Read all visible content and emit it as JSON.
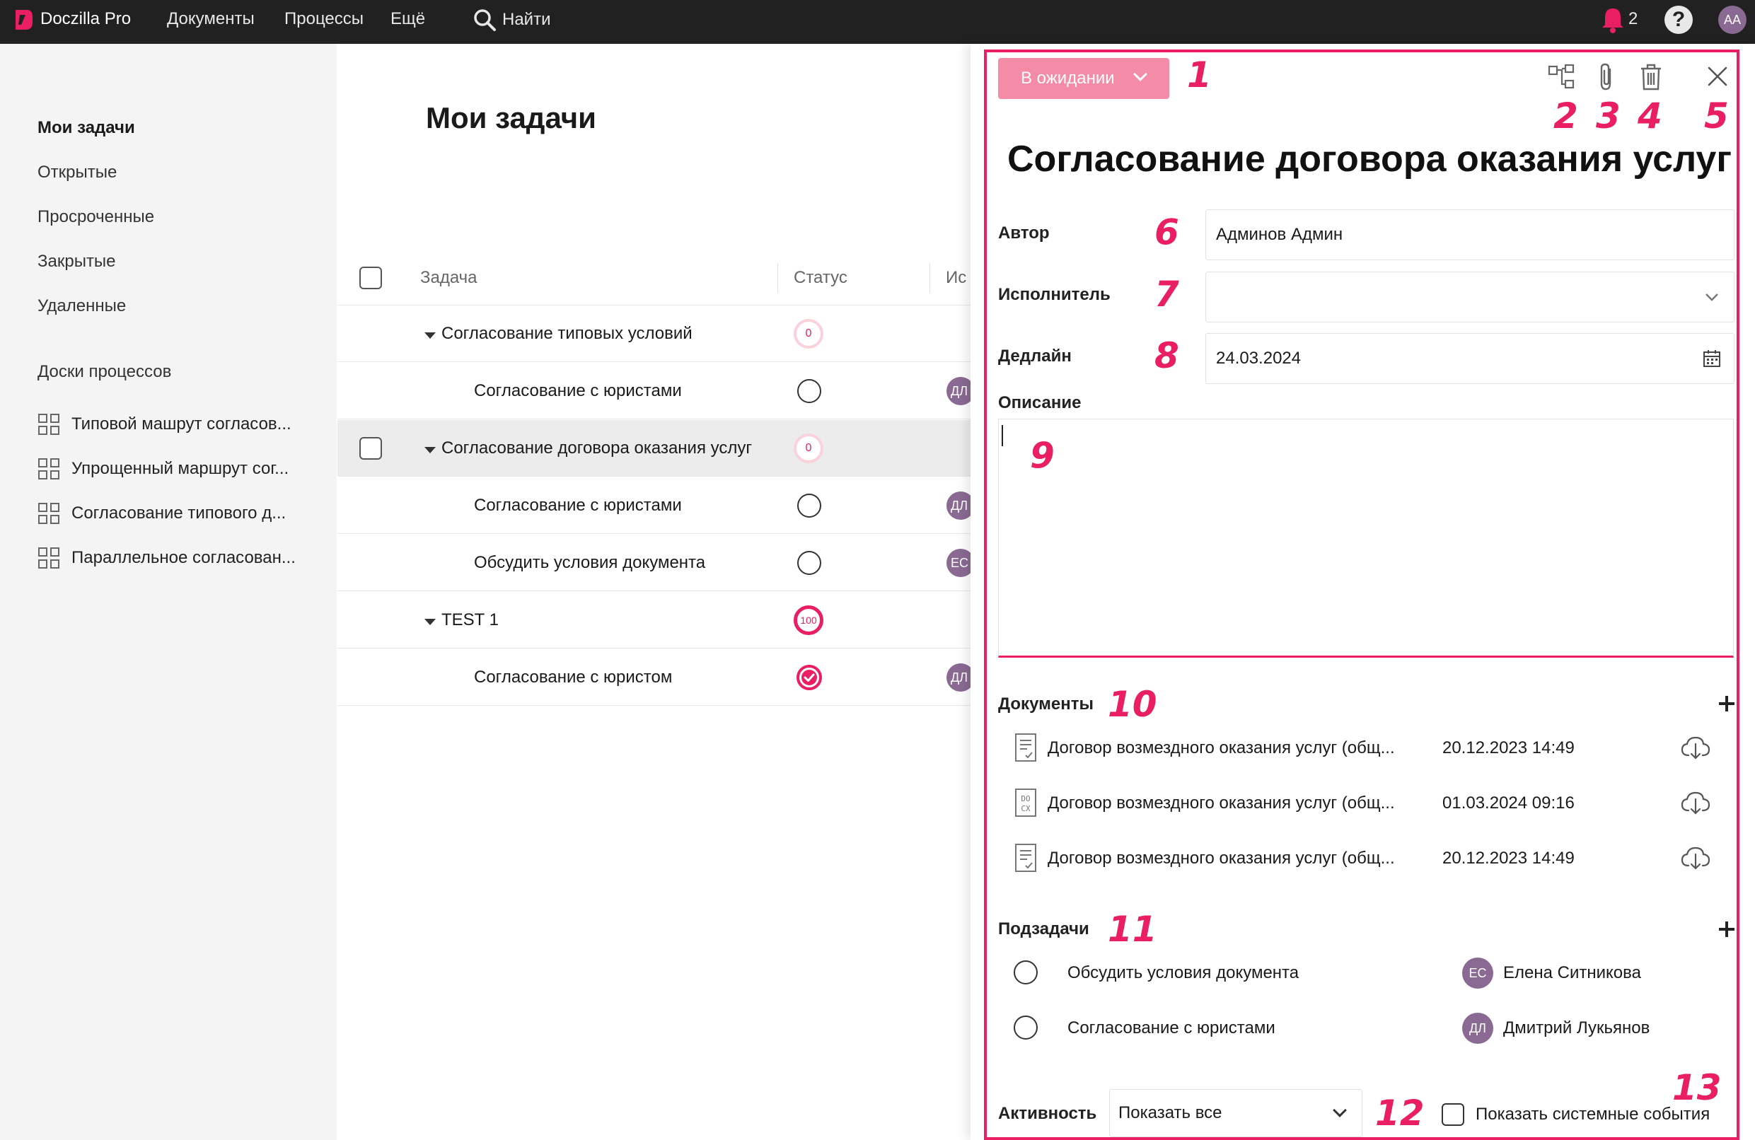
{
  "app": {
    "name": "Doczilla Pro"
  },
  "nav": {
    "documents": "Документы",
    "processes": "Процессы",
    "more": "Ещё",
    "search": "Найти"
  },
  "notifications": {
    "count": "2"
  },
  "help": {
    "label": "?"
  },
  "user": {
    "initials": "AA"
  },
  "sidebar": {
    "items": [
      {
        "label": "Мои задачи"
      },
      {
        "label": "Открытые"
      },
      {
        "label": "Просроченные"
      },
      {
        "label": "Закрытые"
      },
      {
        "label": "Удаленные"
      }
    ],
    "boards_heading": "Доски процессов",
    "boards": [
      {
        "label": "Типовой машрут согласов..."
      },
      {
        "label": "Упрощенный маршрут сог..."
      },
      {
        "label": "Согласование типового д..."
      },
      {
        "label": "Параллельное согласован..."
      }
    ]
  },
  "main": {
    "title": "Мои задачи",
    "columns": {
      "task": "Задача",
      "status": "Статус",
      "assignee": "Ис"
    },
    "rows": [
      {
        "name": "Согласование типовых условий",
        "progress": "0"
      },
      {
        "name": "Согласование с юристами",
        "avatar": "ДЛ"
      },
      {
        "name": "Согласование договора оказания услуг",
        "progress": "0"
      },
      {
        "name": "Согласование с юристами",
        "avatar": "ДЛ"
      },
      {
        "name": "Обсудить условия документа",
        "avatar": "ЕС"
      },
      {
        "name": "TEST 1",
        "progress": "100"
      },
      {
        "name": "Согласование с юристом",
        "avatar": "ДЛ"
      }
    ]
  },
  "detail": {
    "status_button": "В ожидании",
    "title": "Согласование договора оказания услуг",
    "author_label": "Автор",
    "author_value": "Админов Админ",
    "assignee_label": "Исполнитель",
    "assignee_value": "",
    "deadline_label": "Дедлайн",
    "deadline_value": "24.03.2024",
    "description_label": "Описание",
    "documents_label": "Документы",
    "documents": [
      {
        "name": "Договор возмездного оказания услуг (общ...",
        "date": "20.12.2023 14:49",
        "icon": "document-check-icon"
      },
      {
        "name": "Договор возмездного оказания услуг (общ...",
        "date": "01.03.2024 09:16",
        "icon": "docx-file-icon"
      },
      {
        "name": "Договор возмездного оказания услуг (общ...",
        "date": "20.12.2023 14:49",
        "icon": "document-check-icon"
      }
    ],
    "subtasks_label": "Подзадачи",
    "subtasks": [
      {
        "name": "Обсудить условия документа",
        "avatar": "ЕС",
        "user": "Елена Ситникова"
      },
      {
        "name": "Согласование с юристами",
        "avatar": "ДЛ",
        "user": "Дмитрий Лукьянов"
      }
    ],
    "activity_label": "Активность",
    "activity_filter": "Показать все",
    "system_events_label": "Показать системные события"
  },
  "annotations": [
    "1",
    "2",
    "3",
    "4",
    "5",
    "6",
    "7",
    "8",
    "9",
    "10",
    "11",
    "12",
    "13"
  ],
  "colors": {
    "accent": "#e91e63",
    "status_button": "#f48ca8",
    "topbar": "#212121",
    "avatar": "#8a6a93"
  }
}
